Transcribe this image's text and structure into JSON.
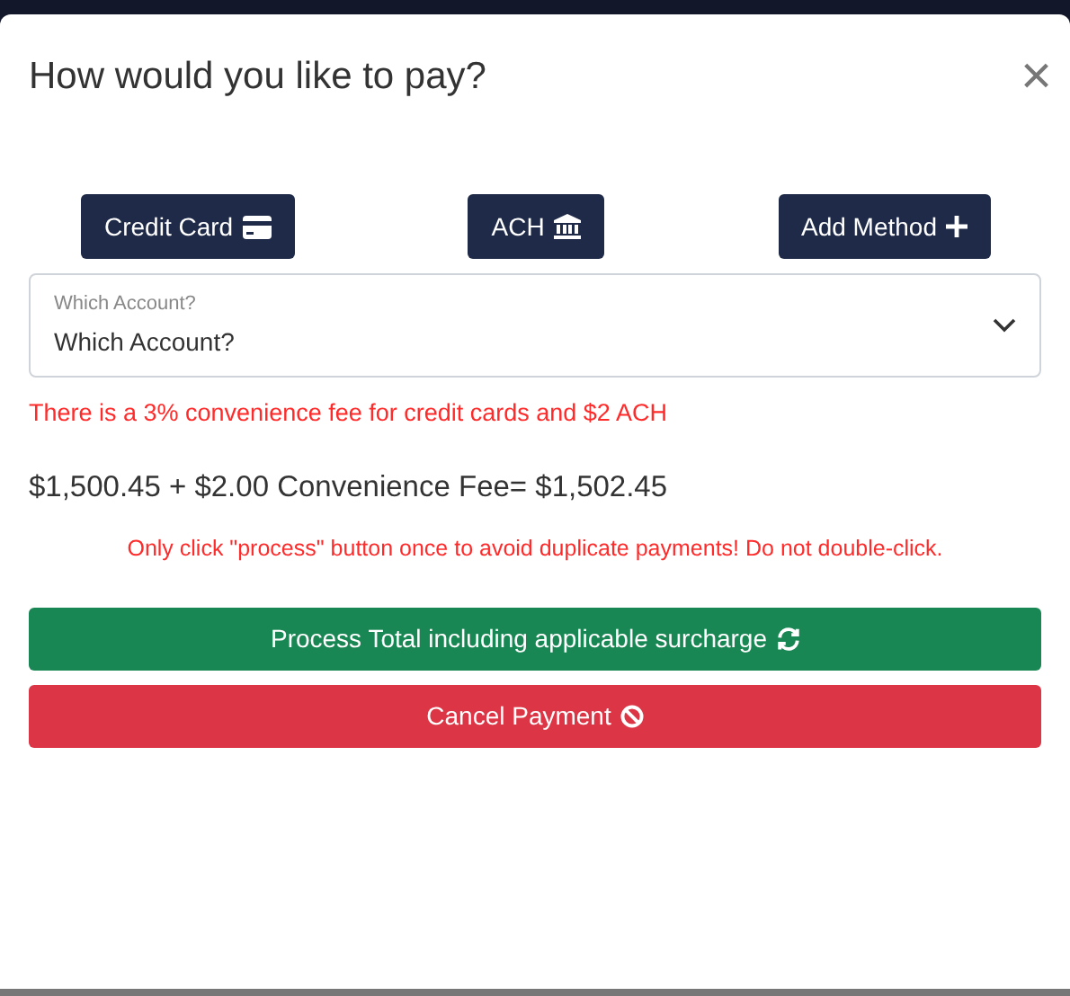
{
  "dialog": {
    "title": "How would you like to pay?",
    "close": "×"
  },
  "methods": [
    {
      "label": "Credit Card",
      "kind": "card"
    },
    {
      "label": "ACH",
      "kind": "bank"
    },
    {
      "label": "Add Method",
      "kind": "add"
    }
  ],
  "account_select": {
    "label": "Which Account?",
    "value": "Which Account?"
  },
  "fee_notice": "There is a 3% convenience fee for credit cards and $2 ACH",
  "total": "$1,500.45 + $2.00 Convenience Fee= $1,502.45",
  "warning": "Only click \"process\" button once to avoid duplicate payments! Do not double-click.",
  "actions": [
    {
      "label": "Process Total including applicable surcharge",
      "kind": "process"
    },
    {
      "label": "Cancel Payment",
      "kind": "cancel"
    }
  ]
}
